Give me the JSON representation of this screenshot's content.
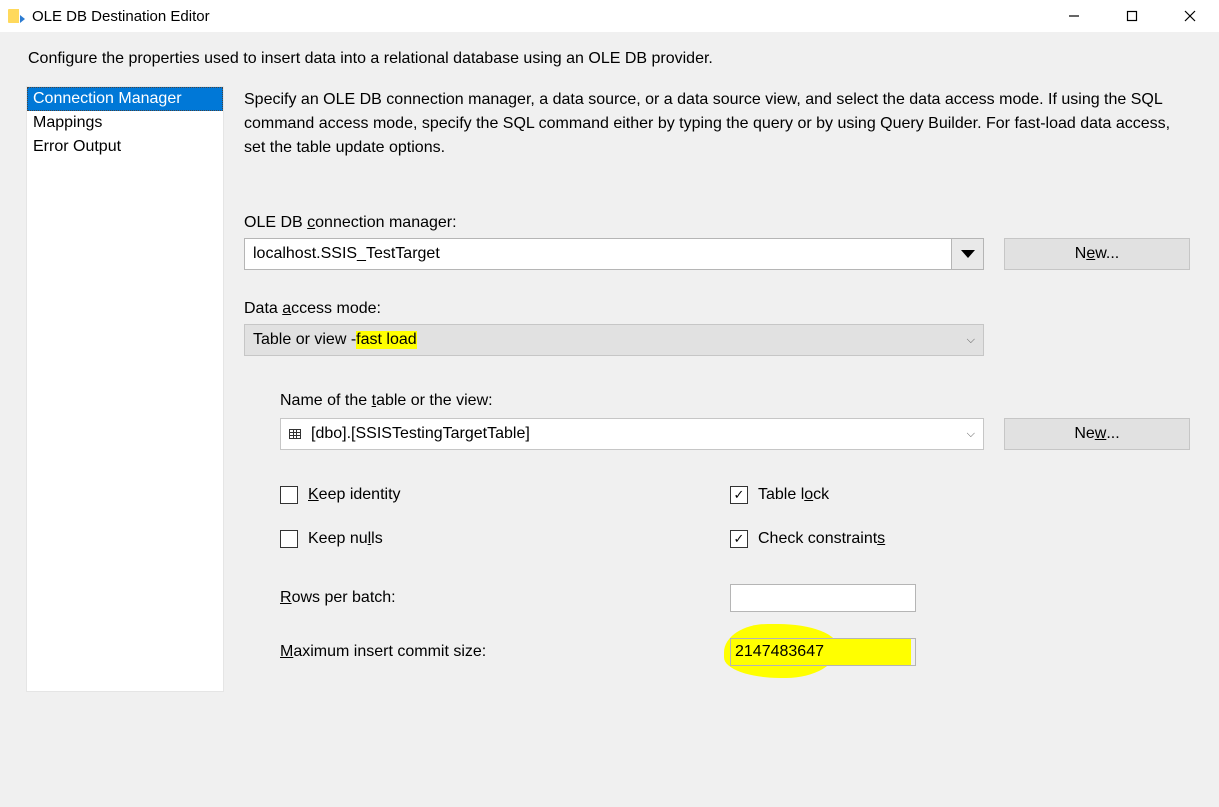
{
  "window": {
    "title": "OLE DB Destination Editor",
    "subtitle": "Configure the properties used to insert data into a relational database using an OLE DB provider."
  },
  "sidebar": {
    "items": [
      {
        "label": "Connection Manager",
        "selected": true
      },
      {
        "label": "Mappings"
      },
      {
        "label": "Error Output"
      }
    ]
  },
  "pane": {
    "description": "Specify an OLE DB connection manager, a data source, or a data source view, and select the data access mode. If using the SQL command access mode, specify the SQL command either by typing the query or by using Query Builder. For fast-load data access, set the table update options.",
    "conn": {
      "label_pre": "OLE DB ",
      "label_ul": "c",
      "label_post": "onnection manager:",
      "value": "localhost.SSIS_TestTarget",
      "new_pre": "N",
      "new_ul": "e",
      "new_post": "w..."
    },
    "mode": {
      "label_pre": "Data ",
      "label_ul": "a",
      "label_post": "ccess mode:",
      "value_pre": "Table or view - ",
      "value_hl": "fast load"
    },
    "table": {
      "label_pre": "Name of the ",
      "label_ul": "t",
      "label_post": "able or the view:",
      "value": "[dbo].[SSISTestingTargetTable]",
      "new_pre": "Ne",
      "new_ul": "w",
      "new_post": "..."
    },
    "checks": {
      "keep_identity": {
        "label_ul": "K",
        "label_post": "eep identity",
        "checked": false
      },
      "table_lock": {
        "label_pre": "Table l",
        "label_ul": "o",
        "label_post": "ck",
        "checked": true
      },
      "keep_nulls": {
        "label_pre": "Keep nu",
        "label_ul": "l",
        "label_post": "ls",
        "checked": false
      },
      "check_constraints": {
        "label_pre": "Check constraint",
        "label_ul": "s",
        "checked": true,
        "highlighted": true
      }
    },
    "rows_batch": {
      "label_ul": "R",
      "label_post": "ows per batch:",
      "value": ""
    },
    "max_commit": {
      "label_ul": "M",
      "label_post": "aximum insert commit size:",
      "value": "2147483647"
    }
  }
}
